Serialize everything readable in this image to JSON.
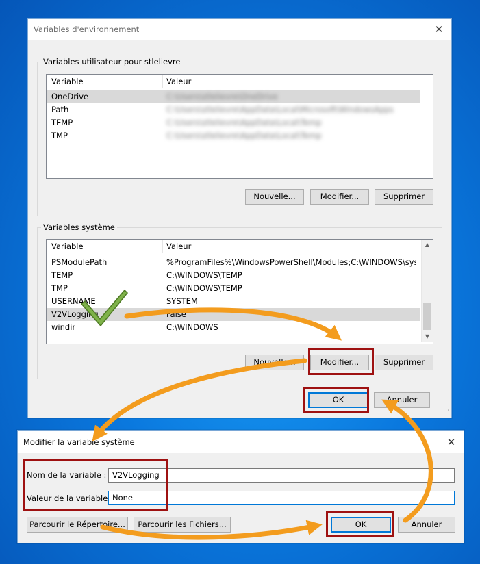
{
  "env_dialog": {
    "title": "Variables d'environnement",
    "user_group_label": "Variables utilisateur pour stlelievre",
    "user_columns": [
      "Variable",
      "Valeur"
    ],
    "user_rows": [
      {
        "name": "OneDrive",
        "value": "C:\\Users\\stlelievre\\OneDrive"
      },
      {
        "name": "Path",
        "value": "C:\\Users\\stlelievre\\AppData\\Local\\Microsoft\\WindowsApps"
      },
      {
        "name": "TEMP",
        "value": "C:\\Users\\stlelievre\\AppData\\Local\\Temp"
      },
      {
        "name": "TMP",
        "value": "C:\\Users\\stlelievre\\AppData\\Local\\Temp"
      }
    ],
    "user_buttons": {
      "new": "Nouvelle...",
      "edit": "Modifier...",
      "delete": "Supprimer"
    },
    "system_group_label": "Variables système",
    "system_columns": [
      "Variable",
      "Valeur"
    ],
    "system_rows": [
      {
        "name": "PSModulePath",
        "value": "%ProgramFiles%\\WindowsPowerShell\\Modules;C:\\WINDOWS\\syst..."
      },
      {
        "name": "TEMP",
        "value": "C:\\WINDOWS\\TEMP"
      },
      {
        "name": "TMP",
        "value": "C:\\WINDOWS\\TEMP"
      },
      {
        "name": "USERNAME",
        "value": "SYSTEM"
      },
      {
        "name": "V2VLogging",
        "value": "False"
      },
      {
        "name": "windir",
        "value": "C:\\WINDOWS"
      }
    ],
    "system_buttons": {
      "new": "Nouvelle...",
      "edit": "Modifier...",
      "delete": "Supprimer"
    },
    "ok": "OK",
    "cancel": "Annuler"
  },
  "edit_dialog": {
    "title": "Modifier la variable système",
    "name_label": "Nom de la variable :",
    "name_value": "V2VLogging",
    "value_label": "Valeur de la variable :",
    "value_value": "None",
    "browse_dir": "Parcourir le Répertoire...",
    "browse_files": "Parcourir les Fichiers...",
    "ok": "OK",
    "cancel": "Annuler"
  },
  "colors": {
    "desktop": "#0a78de",
    "annotation_box": "#9e1111",
    "annotation_arrow": "#f39c1e",
    "checkmark": "#7fb24a",
    "focus_border": "#0078d7"
  },
  "icons": {
    "close": "close-icon",
    "check": "checkmark-icon",
    "arrow": "curved-arrow-icon",
    "scroll_up": "scroll-up-icon",
    "scroll_down": "scroll-down-icon",
    "grip": "resize-grip-icon"
  }
}
